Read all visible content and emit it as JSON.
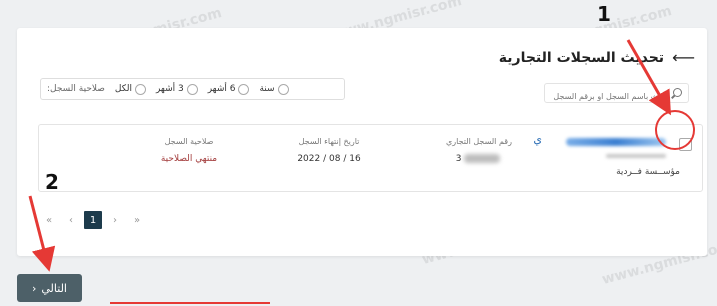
{
  "header": {
    "title": "تحديث السجلات التجارية",
    "back_icon": "arrow-left-icon"
  },
  "search": {
    "placeholder": "بحث باسم السجل او برقم السجل"
  },
  "filter": {
    "label": "صلاحية السجل:",
    "options": [
      "الكل",
      "3 أشهر",
      "6 أشهر",
      "سنة"
    ]
  },
  "record": {
    "entity_type": "مؤســسة فــردية",
    "number_label": "رقم السجل التجاري",
    "number_value_suffix": "3",
    "expiry_label": "تاريخ إنتهاء السجل",
    "expiry_value": "16 / 08 / 2022",
    "validity_label": "صلاحية السجل",
    "validity_value": "منتهي الصلاحية",
    "name_char": "ي"
  },
  "pagination": {
    "first": "«",
    "prev": "‹",
    "current": "1",
    "next": "›",
    "last": "»"
  },
  "footer": {
    "next_label": "التالي",
    "next_chevron": "›"
  },
  "annotations": {
    "one": "1",
    "two": "2"
  },
  "watermark": "www.ngmisr.com",
  "colors": {
    "next_button": "#4d6068",
    "active_page": "#1d3b4c",
    "expired": "#a23a3a",
    "annotation": "#e53935"
  }
}
